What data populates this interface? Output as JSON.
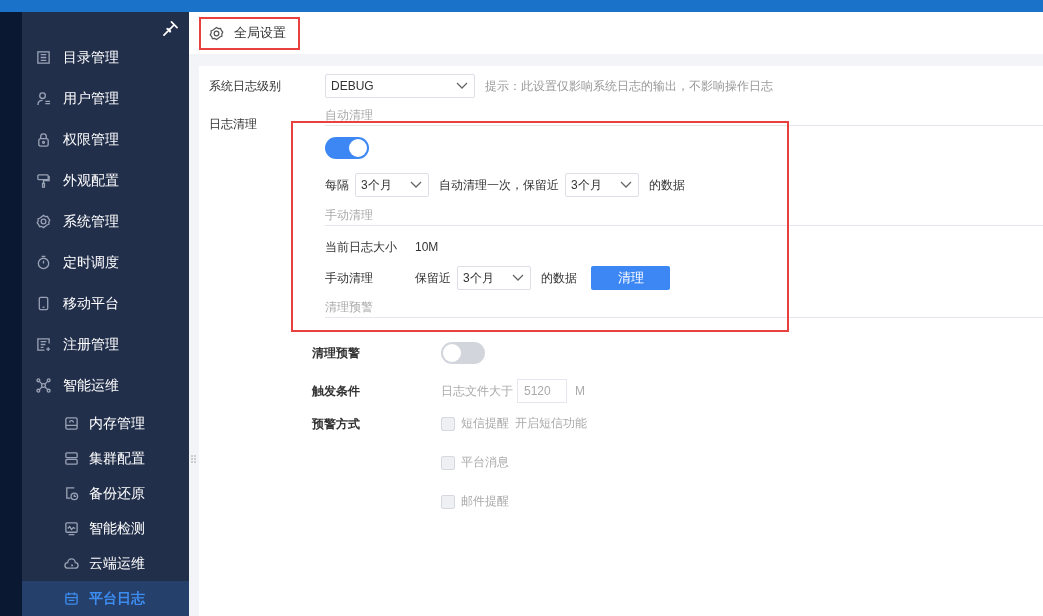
{
  "sidebar": {
    "items": [
      {
        "label": "目录管理",
        "selected": false
      },
      {
        "label": "用户管理",
        "selected": false
      },
      {
        "label": "权限管理",
        "selected": false
      },
      {
        "label": "外观配置",
        "selected": false
      },
      {
        "label": "系统管理",
        "selected": false
      },
      {
        "label": "定时调度",
        "selected": false
      },
      {
        "label": "移动平台",
        "selected": false
      },
      {
        "label": "注册管理",
        "selected": false
      },
      {
        "label": "智能运维",
        "selected": false,
        "children": [
          {
            "label": "内存管理",
            "selected": false
          },
          {
            "label": "集群配置",
            "selected": false
          },
          {
            "label": "备份还原",
            "selected": false
          },
          {
            "label": "智能检测",
            "selected": false
          },
          {
            "label": "云端运维",
            "selected": false
          },
          {
            "label": "平台日志",
            "selected": true
          }
        ]
      }
    ]
  },
  "tabs": [
    {
      "label": "全局设置",
      "selected": true,
      "highlighted": true
    }
  ],
  "form": {
    "log_level": {
      "label": "系统日志级别",
      "value": "DEBUG",
      "hint": "提示：此设置仅影响系统日志的输出，不影响操作日志"
    },
    "log_cleanup": {
      "label": "日志清理",
      "highlighted": true,
      "auto": {
        "title": "自动清理",
        "on": true,
        "prefix": "每隔",
        "interval": "3个月",
        "middle": "自动清理一次，保留近",
        "keep": "3个月",
        "suffix": "的数据"
      },
      "manual": {
        "title": "手动清理",
        "size_label": "当前日志大小",
        "size": "10M",
        "label": "手动清理",
        "prefix": "保留近",
        "keep": "3个月",
        "suffix": "的数据",
        "button": "清理"
      },
      "warning_title": "清理预警"
    },
    "warning": {
      "label": "清理预警",
      "on": false,
      "trigger_label": "触发条件",
      "trigger_text": "日志文件大于",
      "threshold": "5120",
      "threshold_disabled": true,
      "unit": "M",
      "method_label": "预警方式",
      "methods": [
        {
          "label": "短信提醒",
          "checked": false,
          "disabled": true,
          "note": "开启短信功能"
        },
        {
          "label": "平台消息",
          "checked": false,
          "disabled": true
        },
        {
          "label": "邮件提醒",
          "checked": false,
          "disabled": true
        }
      ]
    }
  }
}
